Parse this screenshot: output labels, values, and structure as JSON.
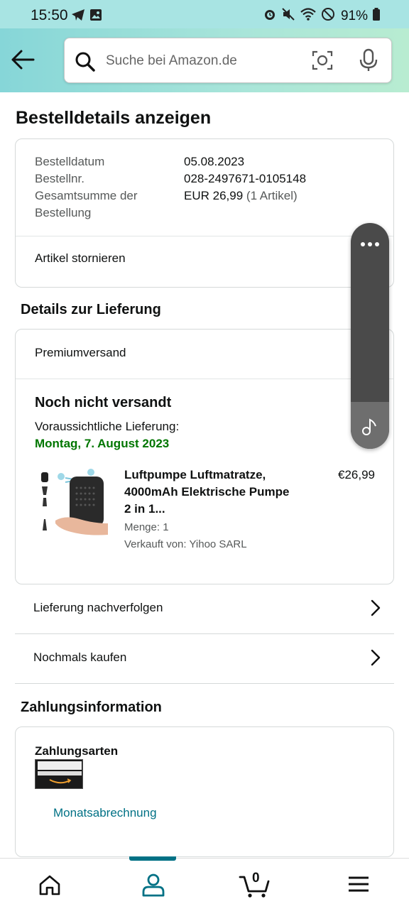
{
  "status_bar": {
    "time": "15:50",
    "battery": "91%"
  },
  "header": {
    "search_placeholder": "Suche bei Amazon.de"
  },
  "page_title": "Bestelldetails anzeigen",
  "order": {
    "date_label": "Bestelldatum",
    "date_value": "05.08.2023",
    "number_label": "Bestellnr.",
    "number_value": "028-2497671-0105148",
    "total_label_line1": "Gesamtsumme der",
    "total_label_line2": "Bestellung",
    "total_value": "EUR 26,99",
    "total_items": "(1 Artikel)",
    "cancel_label": "Artikel stornieren"
  },
  "delivery": {
    "section_title": "Details zur Lieferung",
    "shipping_type": "Premiumversand",
    "status": "Noch nicht versandt",
    "eta_label": "Voraussichtliche Lieferung:",
    "eta_date": "Montag, 7. August 2023",
    "product": {
      "title": "Luftpumpe Luftmatratze, 4000mAh Elektrische Pumpe 2 in 1...",
      "price": "€26,99",
      "qty": "Menge: 1",
      "seller": "Verkauft von: Yihoo SARL"
    }
  },
  "links": {
    "track": "Lieferung nachverfolgen",
    "buy_again": "Nochmals kaufen"
  },
  "payment": {
    "section_title": "Zahlungsinformation",
    "methods_title": "Zahlungsarten",
    "method_name": "Monatsabrechnung"
  },
  "bottom_nav": {
    "cart_count": "0"
  },
  "colors": {
    "header_teal": "#a8e4e3",
    "green_delivery": "#007600",
    "link_teal": "#007185",
    "active_nav": "#007185"
  }
}
